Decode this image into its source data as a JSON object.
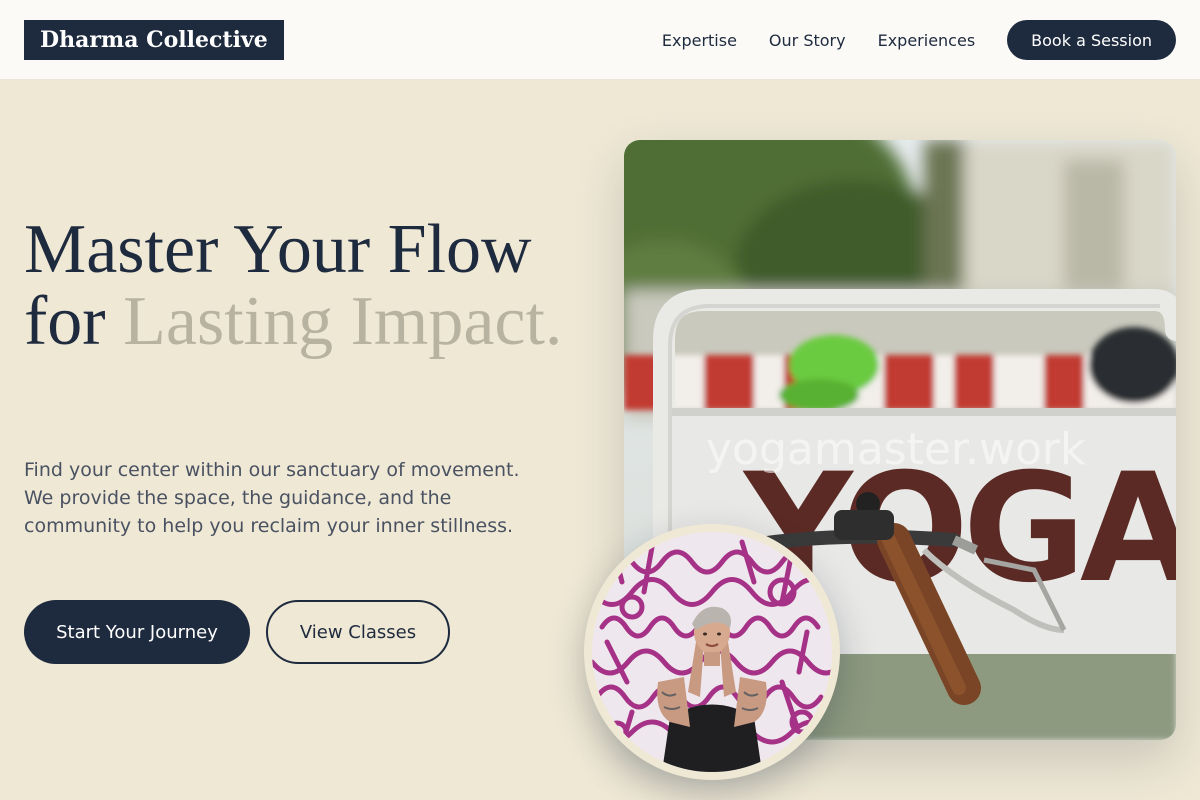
{
  "brand": {
    "name": "Dharma Collective"
  },
  "nav": {
    "links": [
      "Expertise",
      "Our Story",
      "Experiences"
    ],
    "cta": "Book a Session"
  },
  "hero": {
    "title_line1": "Master Your Flow",
    "title_for": "for ",
    "title_accent": "Lasting Impact.",
    "description": "Find your center within our sanctuary of movement. We provide the space, the guidance, and the community to help you reclaim your inner stillness.",
    "primary_cta": "Start Your Journey",
    "secondary_cta": "View Classes"
  },
  "image": {
    "sign_text": "YOGA",
    "watermark": "yogamaster.work"
  },
  "colors": {
    "navy": "#1e2a3e",
    "cream": "#efe8d5",
    "accent_muted": "#b8b3a0"
  }
}
